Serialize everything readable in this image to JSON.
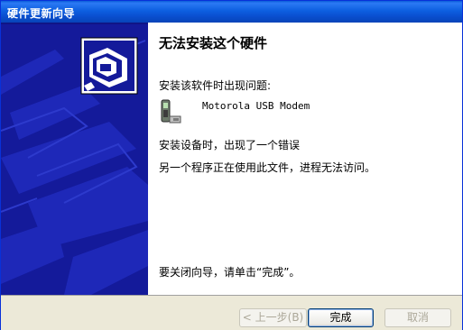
{
  "window": {
    "title": "硬件更新向导"
  },
  "content": {
    "heading": "无法安装这个硬件",
    "problem_intro": "安装该软件时出现问题:",
    "device_name": "Motorola USB Modem",
    "error_line1": "安装设备时，出现了一个错误",
    "error_line2": "另一个程序正在使用此文件，进程无法访问。",
    "close_hint": "要关闭向导，请单击“完成”。"
  },
  "buttons": {
    "back": "< 上一步(B)",
    "finish": "完成",
    "cancel": "取消"
  },
  "colors": {
    "title_bar": "#0a5bd8",
    "side_panel": "#141a9a"
  }
}
